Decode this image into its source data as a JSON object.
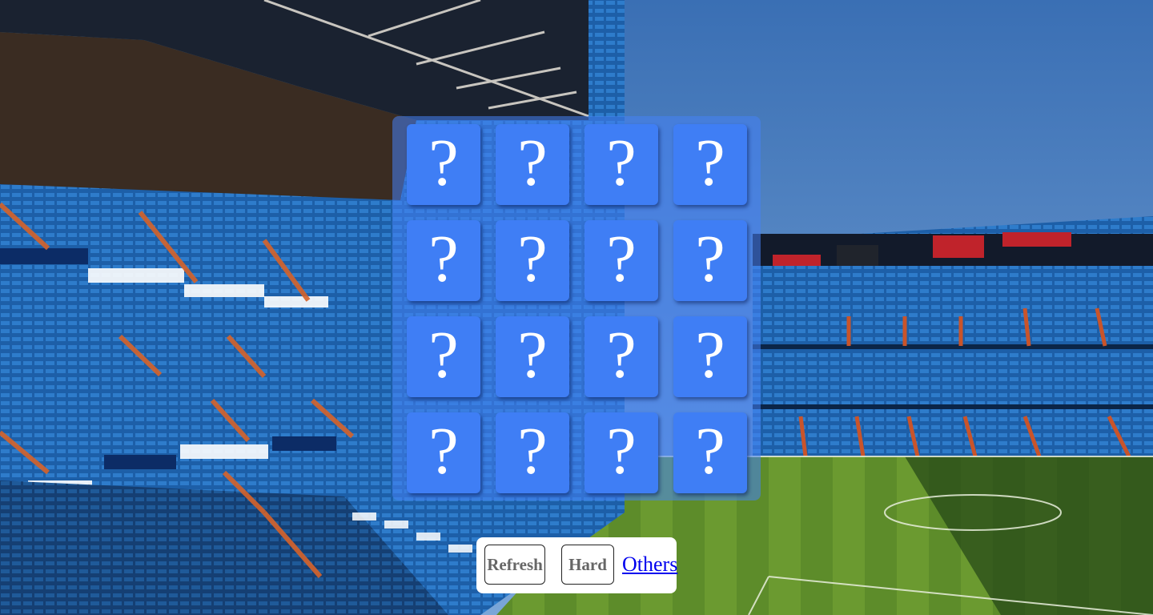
{
  "board": {
    "rows": 4,
    "columns": 4,
    "card_back_symbol": "?",
    "card_color": "#3f7ef5"
  },
  "controls": {
    "refresh_label": "Refresh",
    "hard_label": "Hard",
    "others_label": "Others"
  },
  "colors": {
    "board_overlay": "#4682f5",
    "link": "#0000ee",
    "button_text": "#666666"
  }
}
